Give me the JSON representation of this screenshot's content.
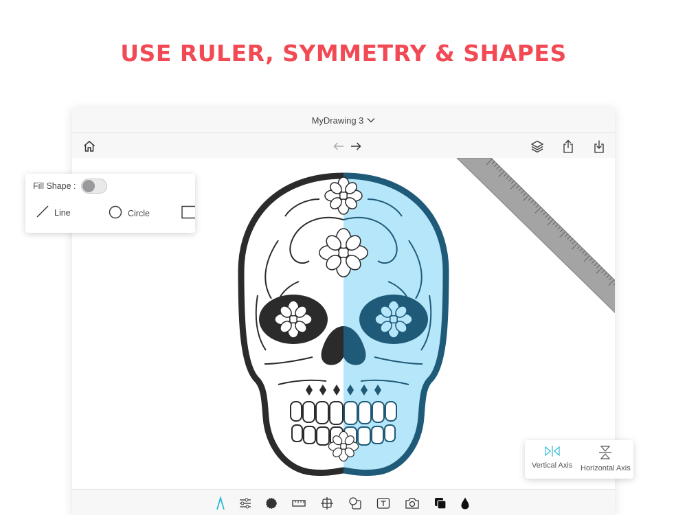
{
  "headline": "USE RULER, SYMMETRY & SHAPES",
  "document": {
    "title": "MyDrawing 3"
  },
  "toolbar": {
    "home": "home-icon",
    "undo": "undo-arrow-icon",
    "redo": "redo-arrow-icon",
    "layers": "layers-icon",
    "share": "share-icon",
    "import": "import-icon"
  },
  "shape_popup": {
    "fill_label": "Fill Shape :",
    "fill_on": false,
    "shapes": [
      {
        "label": "Line",
        "icon": "line-icon"
      },
      {
        "label": "Circle",
        "icon": "circle-icon"
      },
      {
        "label": "",
        "icon": "rectangle-icon"
      }
    ]
  },
  "axis_popup": {
    "options": [
      {
        "label": "Vertical Axis",
        "icon": "vertical-axis-icon",
        "active": true
      },
      {
        "label": "Horizontal Axis",
        "icon": "horizontal-axis-icon",
        "active": false
      }
    ]
  },
  "bottom_tools": [
    "pen-tool-icon",
    "adjustments-icon",
    "brush-icon",
    "ruler-icon",
    "symmetry-icon",
    "shapes-icon",
    "text-icon",
    "camera-icon",
    "layers-color-icon",
    "ink-drop-icon"
  ],
  "colors": {
    "headline": "#f24a55",
    "accent": "#2bb8d4",
    "skull_dark": "#2b2b2b",
    "skull_blue_fill": "#b5e6fa",
    "skull_blue_stroke": "#1f5a78",
    "ruler": "#a4a4a4"
  }
}
